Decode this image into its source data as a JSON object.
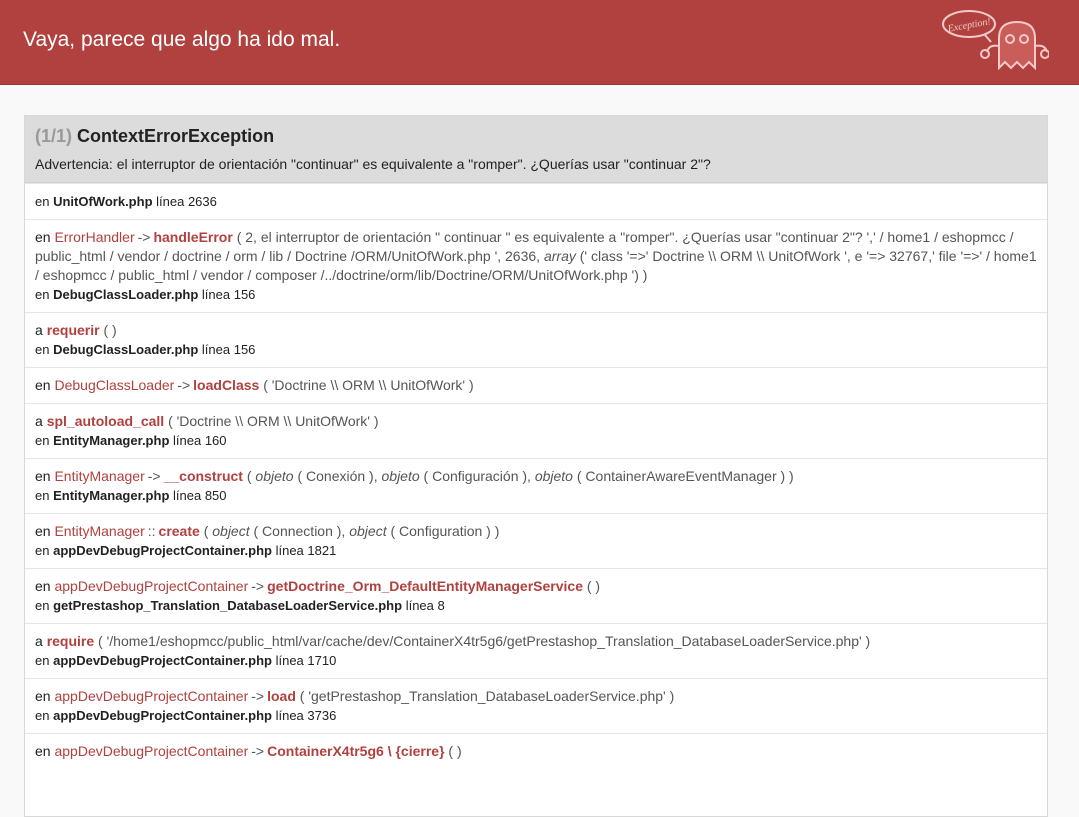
{
  "header": {
    "title": "Vaya, parece que algo ha ido mal.",
    "logo_text": "Exception!"
  },
  "exception": {
    "counter": "(1/1)",
    "name": "ContextErrorException",
    "message": "Advertencia: el interruptor de orientación \"continuar\" es equivalente a \"romper\". ¿Querías usar \"continuar 2\"?"
  },
  "trace": [
    {
      "prefix": "en",
      "file": "UnitOfWork.php",
      "line": "línea 2636"
    },
    {
      "prefix": "en",
      "cls": "ErrorHandler",
      "sep": "->",
      "fn": "handleError",
      "args_a": "( 2, el interruptor de orientación \" continuar \" es equivalente a \"romper\". ¿Querías usar \"continuar 2\"? ',' / home1 / eshopmcc / public_html / vendor / doctrine / orm / lib / Doctrine /ORM/UnitOfWork.php ', 2636,",
      "args_em": "array",
      "args_b": "(' class '=>' Doctrine \\\\ ORM \\\\ UnitOfWork ', e '=> 32767,' file '=>' / home1 / eshopmcc / public_html / vendor / composer /../doctrine/orm/lib/Doctrine/ORM/UnitOfWork.php ') )",
      "file_prefix": "en",
      "file": "DebugClassLoader.php",
      "line": "línea 156"
    },
    {
      "prefix": "a",
      "fn": "requerir",
      "args": "( )",
      "file_prefix": "en",
      "file": "DebugClassLoader.php",
      "line": "línea 156"
    },
    {
      "prefix": "en",
      "cls": "DebugClassLoader",
      "sep": "->",
      "fn": "loadClass",
      "args": "( 'Doctrine \\\\ ORM \\\\ UnitOfWork' )"
    },
    {
      "prefix": "a",
      "fn": "spl_autoload_call",
      "args": "( 'Doctrine \\\\ ORM \\\\ UnitOfWork' )",
      "file_prefix": "en",
      "file": "EntityManager.php",
      "line": "línea 160"
    },
    {
      "prefix": "en",
      "cls": "EntityManager",
      "sep": "->",
      "fn": "__construct",
      "em1": "objeto",
      "a1": "( Conexión ),",
      "em2": "objeto",
      "a2": "( Configuración ),",
      "em3": "objeto",
      "a3": "( ContainerAwareEventManager ) )",
      "file_prefix": "en",
      "file": "EntityManager.php",
      "line": "línea 850"
    },
    {
      "prefix": "en",
      "cls": "EntityManager",
      "sep": "::",
      "fn": "create",
      "em1": "object",
      "a1": "( Connection ),",
      "em2": "object",
      "a2": "( Configuration ) )",
      "file_prefix": "en",
      "file": "appDevDebugProjectContainer.php",
      "line": "línea 1821"
    },
    {
      "prefix": "en",
      "cls": "appDevDebugProjectContainer",
      "sep": "->",
      "fn": "getDoctrine_Orm_DefaultEntityManagerService",
      "args": "( )",
      "file_prefix": "en",
      "file": "getPrestashop_Translation_DatabaseLoaderService.php",
      "line": "línea 8"
    },
    {
      "prefix": "a",
      "fn": "require",
      "args": "( '/home1/eshopmcc/public_html/var/cache/dev/ContainerX4tr5g6/getPrestashop_Translation_DatabaseLoaderService.php' )",
      "file_prefix": "en",
      "file": "appDevDebugProjectContainer.php",
      "line": "línea 1710"
    },
    {
      "prefix": "en",
      "cls": "appDevDebugProjectContainer",
      "sep": "->",
      "fn": "load",
      "args": "( 'getPrestashop_Translation_DatabaseLoaderService.php' )",
      "file_prefix": "en",
      "file": "appDevDebugProjectContainer.php",
      "line": "línea 3736"
    },
    {
      "prefix": "en",
      "cls": "appDevDebugProjectContainer",
      "sep": "->",
      "fn": "ContainerX4tr5g6 \\ {cierre}",
      "args": "( )"
    }
  ]
}
